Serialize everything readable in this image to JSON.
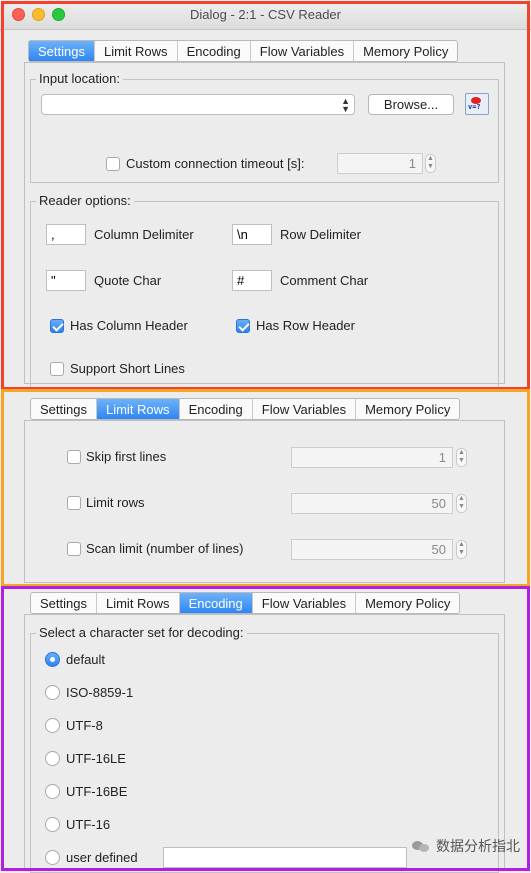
{
  "window": {
    "title": "Dialog - 2:1 - CSV Reader"
  },
  "tabs": [
    "Settings",
    "Limit Rows",
    "Encoding",
    "Flow Variables",
    "Memory Policy"
  ],
  "settings": {
    "input_location_title": "Input location:",
    "browse_label": "Browse...",
    "timeout_label": "Custom connection timeout [s]:",
    "timeout_value": "1",
    "reader_options_title": "Reader options:",
    "column_delimiter_value": ",",
    "column_delimiter_label": "Column Delimiter",
    "row_delimiter_value": "\\n",
    "row_delimiter_label": "Row Delimiter",
    "quote_char_value": "\"",
    "quote_char_label": "Quote Char",
    "comment_char_value": "#",
    "comment_char_label": "Comment Char",
    "has_column_header_label": "Has Column Header",
    "has_row_header_label": "Has Row Header",
    "support_short_lines_label": "Support Short Lines"
  },
  "limit_rows": {
    "skip_first_lines_label": "Skip first lines",
    "skip_first_lines_value": "1",
    "limit_rows_label": "Limit rows",
    "limit_rows_value": "50",
    "scan_limit_label": "Scan limit (number of lines)",
    "scan_limit_value": "50"
  },
  "encoding": {
    "title": "Select a character set for decoding:",
    "options": [
      "default",
      "ISO-8859-1",
      "UTF-8",
      "UTF-16LE",
      "UTF-16BE",
      "UTF-16",
      "user defined"
    ],
    "selected": "default"
  },
  "watermark": "数据分析指北",
  "colors": {
    "frame_settings": "#f2422f",
    "frame_limit_rows": "#f5a623",
    "frame_encoding": "#b41ee0",
    "tab_active": "#2f86f1"
  }
}
